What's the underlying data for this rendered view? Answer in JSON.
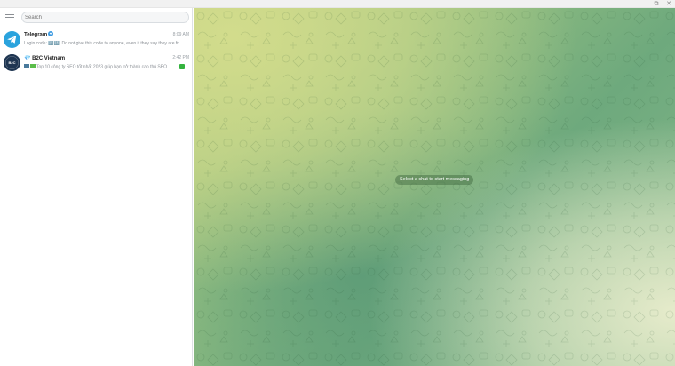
{
  "window": {
    "controls": [
      "–",
      "⧉",
      "✕"
    ]
  },
  "sidebar": {
    "search_placeholder": "Search",
    "chats": [
      {
        "name": "Telegram",
        "verified": true,
        "time": "8:09 AM",
        "preview": "Login code: 🔢🔢. Do not give this code to anyone, even if they say they are fr...",
        "avatar_color": "#2aa3dd",
        "avatar_icon": "paper-plane-icon"
      },
      {
        "name": "💎 B2C Vietnam",
        "time": "2:42 PM",
        "preview": "Top 10 công ty SEO tốt nhất 2023 giúp bạn trở thành cao thủ SEO",
        "avatar_color": "#1e3551",
        "avatar_text": "B2C",
        "avatar_icon": "b2c-logo-icon"
      }
    ]
  },
  "main": {
    "empty_message": "Select a chat to start messaging"
  },
  "colors": {
    "accent": "#2aa3dd",
    "pill_bg": "rgba(60,100,60,0.45)"
  }
}
